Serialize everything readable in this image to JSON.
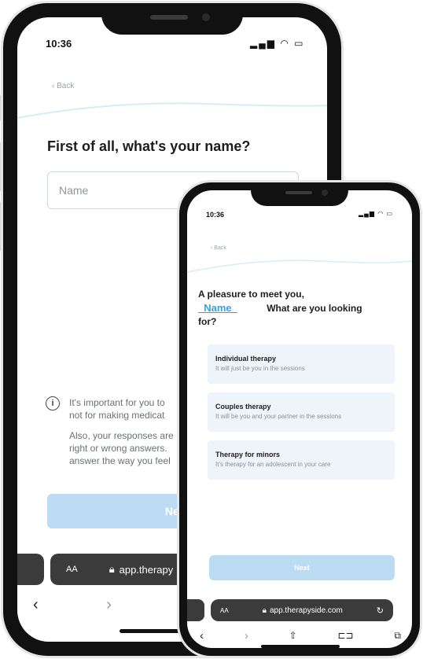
{
  "phone_back": {
    "status_time": "10:36",
    "back_label": "‹ Back",
    "question": "First of all, what's your name?",
    "name_placeholder": "Name",
    "info_icon_glyph": "i",
    "info_lines": [
      "It's important for you to",
      "not for making medicat",
      "Also, your responses are",
      "right or wrong answers.",
      "answer the way you feel"
    ],
    "next_label": "Next",
    "browser": {
      "text_size_label": "AA",
      "url": "app.therapy"
    },
    "toolbar": {
      "back_icon": "chevron-left-icon",
      "forward_icon": "chevron-right-icon",
      "share_icon": "share-icon"
    }
  },
  "phone_front": {
    "status_time": "10:36",
    "back_label": "‹ Back",
    "greeting_prefix": "A pleasure to meet you,",
    "name_token": "_Name_",
    "greeting_suffix": "What are you looking",
    "greeting_end": "for?",
    "options": [
      {
        "title": "Individual therapy",
        "desc": "It will just be you in the sessions"
      },
      {
        "title": "Couples therapy",
        "desc": "It will be you and your partner in the sessions"
      },
      {
        "title": "Therapy for minors",
        "desc": "It's therapy for an adolescent in your care"
      }
    ],
    "next_label": "Next",
    "browser": {
      "text_size_label": "AA",
      "url": "app.therapyside.com",
      "reload_icon": "reload-icon"
    },
    "toolbar": {
      "back_icon": "chevron-left-icon",
      "forward_icon": "chevron-right-icon",
      "share_icon": "share-icon",
      "bookmarks_icon": "book-icon",
      "tabs_icon": "tabs-icon"
    }
  },
  "colors": {
    "accent": "#3aa0e6",
    "button_disabled": "#bcdcf3",
    "option_bg": "#eef4f9",
    "frame": "#111111"
  }
}
